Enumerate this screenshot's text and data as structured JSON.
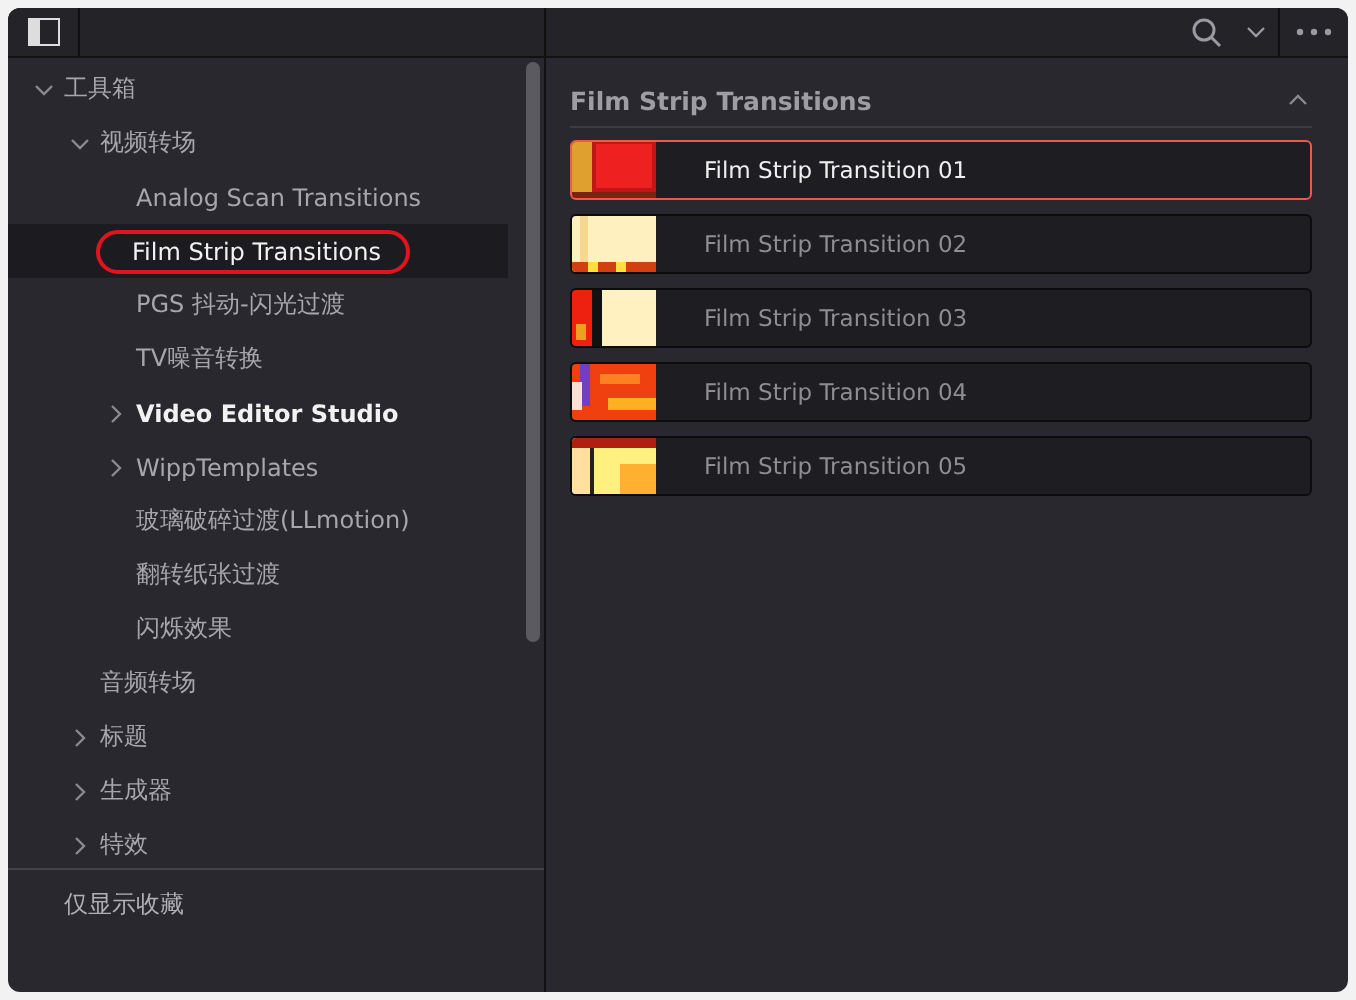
{
  "tree": [
    {
      "label": "工具箱",
      "expanded": true,
      "selected": false,
      "emphasized": false,
      "children": [
        {
          "label": "视频转场",
          "expanded": true,
          "selected": false,
          "emphasized": false,
          "children": [
            {
              "label": "Analog Scan Transitions",
              "selected": false,
              "emphasized": false
            },
            {
              "label": "Film Strip Transitions",
              "selected": true,
              "emphasized": false,
              "circled": true
            },
            {
              "label": "PGS 抖动-闪光过渡",
              "selected": false,
              "emphasized": false
            },
            {
              "label": "TV噪音转换",
              "selected": false,
              "emphasized": false
            },
            {
              "label": "Video Editor Studio",
              "expanded": false,
              "selected": false,
              "emphasized": true
            },
            {
              "label": "WippTemplates",
              "expanded": false,
              "selected": false,
              "emphasized": false
            },
            {
              "label": "玻璃破碎过渡(LLmotion)",
              "selected": false,
              "emphasized": false
            },
            {
              "label": "翻转纸张过渡",
              "selected": false,
              "emphasized": false
            },
            {
              "label": "闪烁效果",
              "selected": false,
              "emphasized": false
            }
          ]
        },
        {
          "label": "音频转场",
          "selected": false,
          "emphasized": false
        },
        {
          "label": "标题",
          "expanded": false,
          "selected": false,
          "emphasized": false
        },
        {
          "label": "生成器",
          "expanded": false,
          "selected": false,
          "emphasized": false
        },
        {
          "label": "特效",
          "expanded": false,
          "selected": false,
          "emphasized": false
        }
      ]
    }
  ],
  "favorites_toggle": "仅显示收藏",
  "section": {
    "title": "Film Strip Transitions",
    "expanded": true
  },
  "clips": [
    {
      "label": "Film Strip Transition 01",
      "selected": true
    },
    {
      "label": "Film Strip Transition 02",
      "selected": false
    },
    {
      "label": "Film Strip Transition 03",
      "selected": false
    },
    {
      "label": "Film Strip Transition 04",
      "selected": false
    },
    {
      "label": "Film Strip Transition 05",
      "selected": false
    }
  ]
}
